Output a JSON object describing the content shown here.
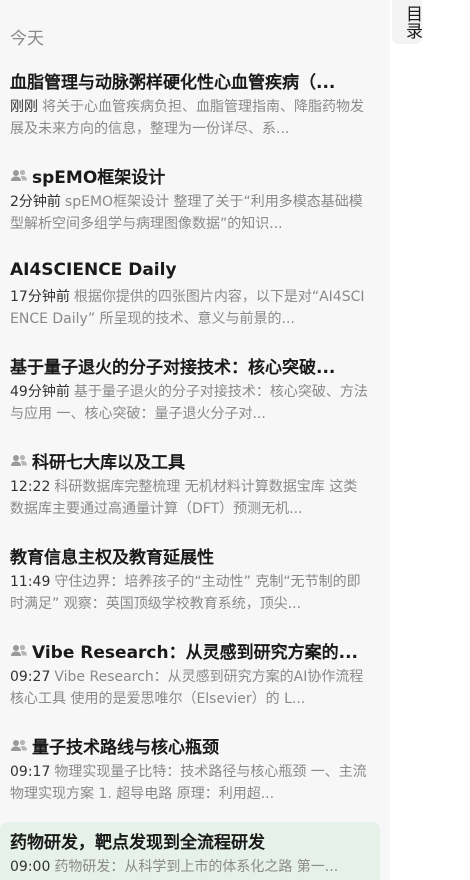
{
  "sidebar": {
    "section_label": "今天",
    "items": [
      {
        "shared": false,
        "title": "血脂管理与动脉粥样硬化性心血管疾病（...",
        "time": "刚刚",
        "preview": "将关于心血管疾病负担、血脂管理指南、降脂药物发展及未来方向的信息，整理为一份详尽、系..."
      },
      {
        "shared": true,
        "title": "spEMO框架设计",
        "time": "2分钟前",
        "preview": "spEMO框架设计 整理了关于“利用多模态基础模型解析空间多组学与病理图像数据”的知识..."
      },
      {
        "shared": false,
        "title": "AI4SCIENCE Daily",
        "time": "17分钟前",
        "preview": "根据你提供的四张图片内容，以下是对“AI4SCIENCE Daily” 所呈现的技术、意义与前景的..."
      },
      {
        "shared": false,
        "title": "基于量子退火的分子对接技术：核心突破...",
        "time": "49分钟前",
        "preview": "基于量子退火的分子对接技术：核心突破、方法与应用 一、核心突破：量子退火分子对..."
      },
      {
        "shared": true,
        "title": "科研七大库以及工具",
        "time": "12:22",
        "preview": "科研数据库完整梳理 无机材料计算数据宝库 这类数据库主要通过高通量计算（DFT）预测无机..."
      },
      {
        "shared": false,
        "title": "教育信息主权及教育延展性",
        "time": "11:49",
        "preview": "守住边界：培养孩子的“主动性” 克制“无节制的即时满足” 观察：英国顶级学校教育系统，顶尖..."
      },
      {
        "shared": true,
        "title": "Vibe Research：从灵感到研究方案的...",
        "time": "09:27",
        "preview": "Vibe Research：从灵感到研究方案的AI协作流程 核心工具 使用的是爱思唯尔（Elsevier）的 L..."
      },
      {
        "shared": true,
        "title": "量子技术路线与核心瓶颈",
        "time": "09:17",
        "preview": "物理实现量子比特：技术路径与核心瓶颈 一、主流物理实现方案 1. 超导电路 原理：利用超..."
      },
      {
        "shared": false,
        "active": true,
        "title": "药物研发，靶点发现到全流程研发",
        "time": "09:00",
        "preview": "药物研发：从科学到上市的体系化之路 第一..."
      }
    ]
  },
  "toc": {
    "label": "目录"
  },
  "colors": {
    "panel_bg": "#f7f7f8",
    "active_bg": "#e6f1ea",
    "muted_text": "#8a8a8a",
    "title_text": "#1a1a1a"
  }
}
